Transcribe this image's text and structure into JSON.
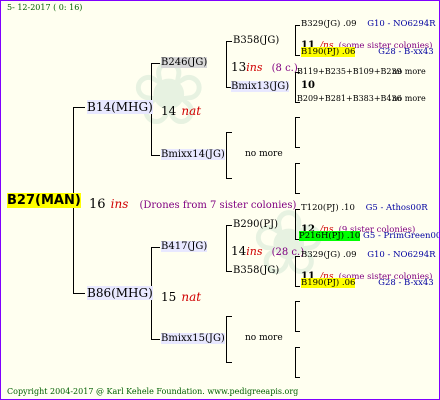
{
  "header": {
    "date": "5- 12-2017 (  0: 16)"
  },
  "footer": {
    "copyright": "Copyright 2004-2017 @ Karl Kehele Foundation.   www.pedigreeapis.org"
  },
  "root": {
    "name": "B27(MAN)"
  },
  "root_info": {
    "num": "16",
    "ins": "ins",
    "note": "(Drones from 7 sister colonies)"
  },
  "g1": {
    "top": {
      "name": "B14(MHG)",
      "num": "14",
      "tag": "nat"
    },
    "bottom": {
      "name": "B86(MHG)",
      "num": "15",
      "tag": "nat"
    }
  },
  "g2": {
    "a": {
      "name": "B246(JG)",
      "num": "13",
      "ins": "ins",
      "note": "(8 c.)"
    },
    "b": {
      "name": "Bmixx14(JG)",
      "nomore": "no more"
    },
    "c": {
      "name": "B417(JG)",
      "num": "14",
      "ins": "ins",
      "note": "(28 c.)"
    },
    "d": {
      "name": "Bmixx15(JG)",
      "nomore": "no more"
    }
  },
  "g3": {
    "a": {
      "name": "B358(JG)"
    },
    "b": {
      "name": "Bmix13(JG)"
    },
    "c": {
      "name": "B290(PJ)"
    },
    "d": {
      "name": "B358(JG)"
    }
  },
  "g4": {
    "a1": {
      "name": "B329(JG) .09",
      "gen": "G10 - NO6294R"
    },
    "a_num": "11",
    "a_ins": "/ns",
    "a_note": "(some sister colonies)",
    "a2": {
      "name": "B190(PJ) .06",
      "gen": "G28 - B-xx43"
    },
    "b1": {
      "name": "B119+B235+B109+B239",
      "more": "no more"
    },
    "b_num": "10",
    "b2": {
      "name": "B209+B281+B383+B436",
      "more": "no more"
    },
    "c1": {
      "name": "T120(PJ) .10",
      "gen": "G5 - Athos00R"
    },
    "c_num": "12",
    "c_ins": "/ns",
    "c_note": "(9 sister colonies)",
    "c2": {
      "name": "P216H(PJ) .10",
      "gen": "G5 - PrimGreen00"
    },
    "d1": {
      "name": "B329(JG) .09",
      "gen": "G10 - NO6294R"
    },
    "d_num": "11",
    "d_ins": "/ns",
    "d_note": "(some sister colonies)",
    "d2": {
      "name": "B190(PJ) .06",
      "gen": "G28 - B-xx43"
    }
  }
}
